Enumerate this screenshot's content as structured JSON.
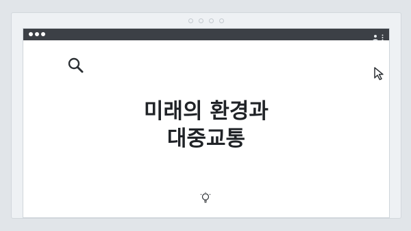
{
  "page": {
    "headline_line1": "미래의 환경과",
    "headline_line2": "대중교통"
  },
  "titlebar": {
    "window_controls": [
      "window-dot",
      "window-dot",
      "window-dot"
    ],
    "right_icons": [
      "profile-icon",
      "kebab-menu-icon"
    ]
  },
  "decorations": {
    "top_dots": 4,
    "icons": [
      "search-icon",
      "cursor-icon",
      "lightbulb-icon"
    ]
  },
  "colors": {
    "background": "#e1e5e9",
    "titlebar": "#3c4046",
    "text": "#202327",
    "icon_stroke": "#2b2f33"
  }
}
